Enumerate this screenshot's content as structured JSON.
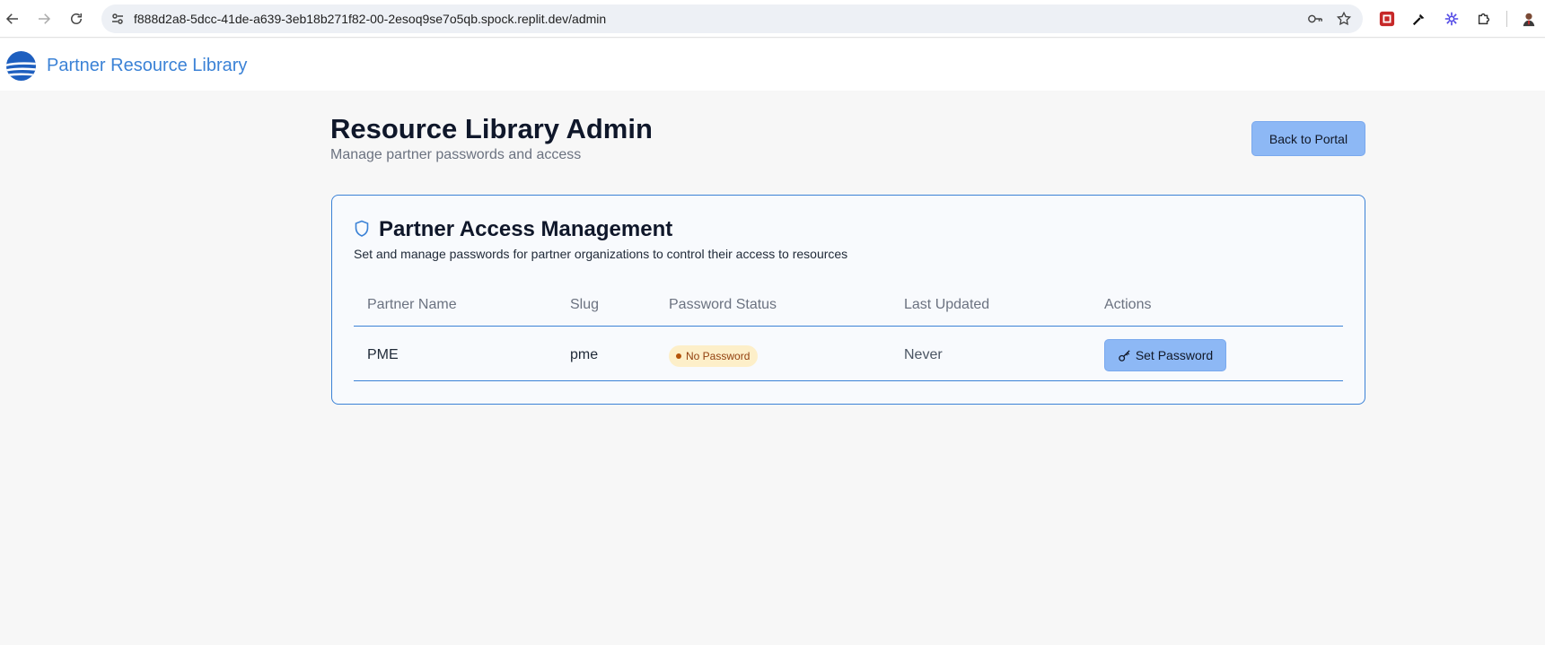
{
  "browser": {
    "url": "f888d2a8-5dcc-41de-a639-3eb18b271f82-00-2esoq9se7o5qb.spock.replit.dev/admin",
    "icons": [
      "back-icon",
      "forward-icon",
      "reload-icon",
      "site-info-icon",
      "password-key-icon",
      "bookmark-star-icon",
      "extension-red-icon",
      "eyedropper-icon",
      "extension-asterisk-icon",
      "extensions-puzzle-icon",
      "profile-avatar-icon"
    ]
  },
  "app": {
    "brand": "Partner Resource Library"
  },
  "page": {
    "title": "Resource Library Admin",
    "subtitle": "Manage partner passwords and access",
    "back_button": "Back to Portal"
  },
  "card": {
    "title": "Partner Access Management",
    "description": "Set and manage passwords for partner organizations to control their access to resources",
    "columns": [
      "Partner Name",
      "Slug",
      "Password Status",
      "Last Updated",
      "Actions"
    ],
    "rows": [
      {
        "partner_name": "PME",
        "slug": "pme",
        "password_status": "No Password",
        "last_updated": "Never",
        "action": "Set Password"
      }
    ]
  },
  "colors": {
    "accent": "#3b82d6",
    "button_bg": "#8db8f5",
    "badge_bg": "#fdefc9",
    "badge_text": "#92400e",
    "page_bg": "#f7f7f7"
  }
}
